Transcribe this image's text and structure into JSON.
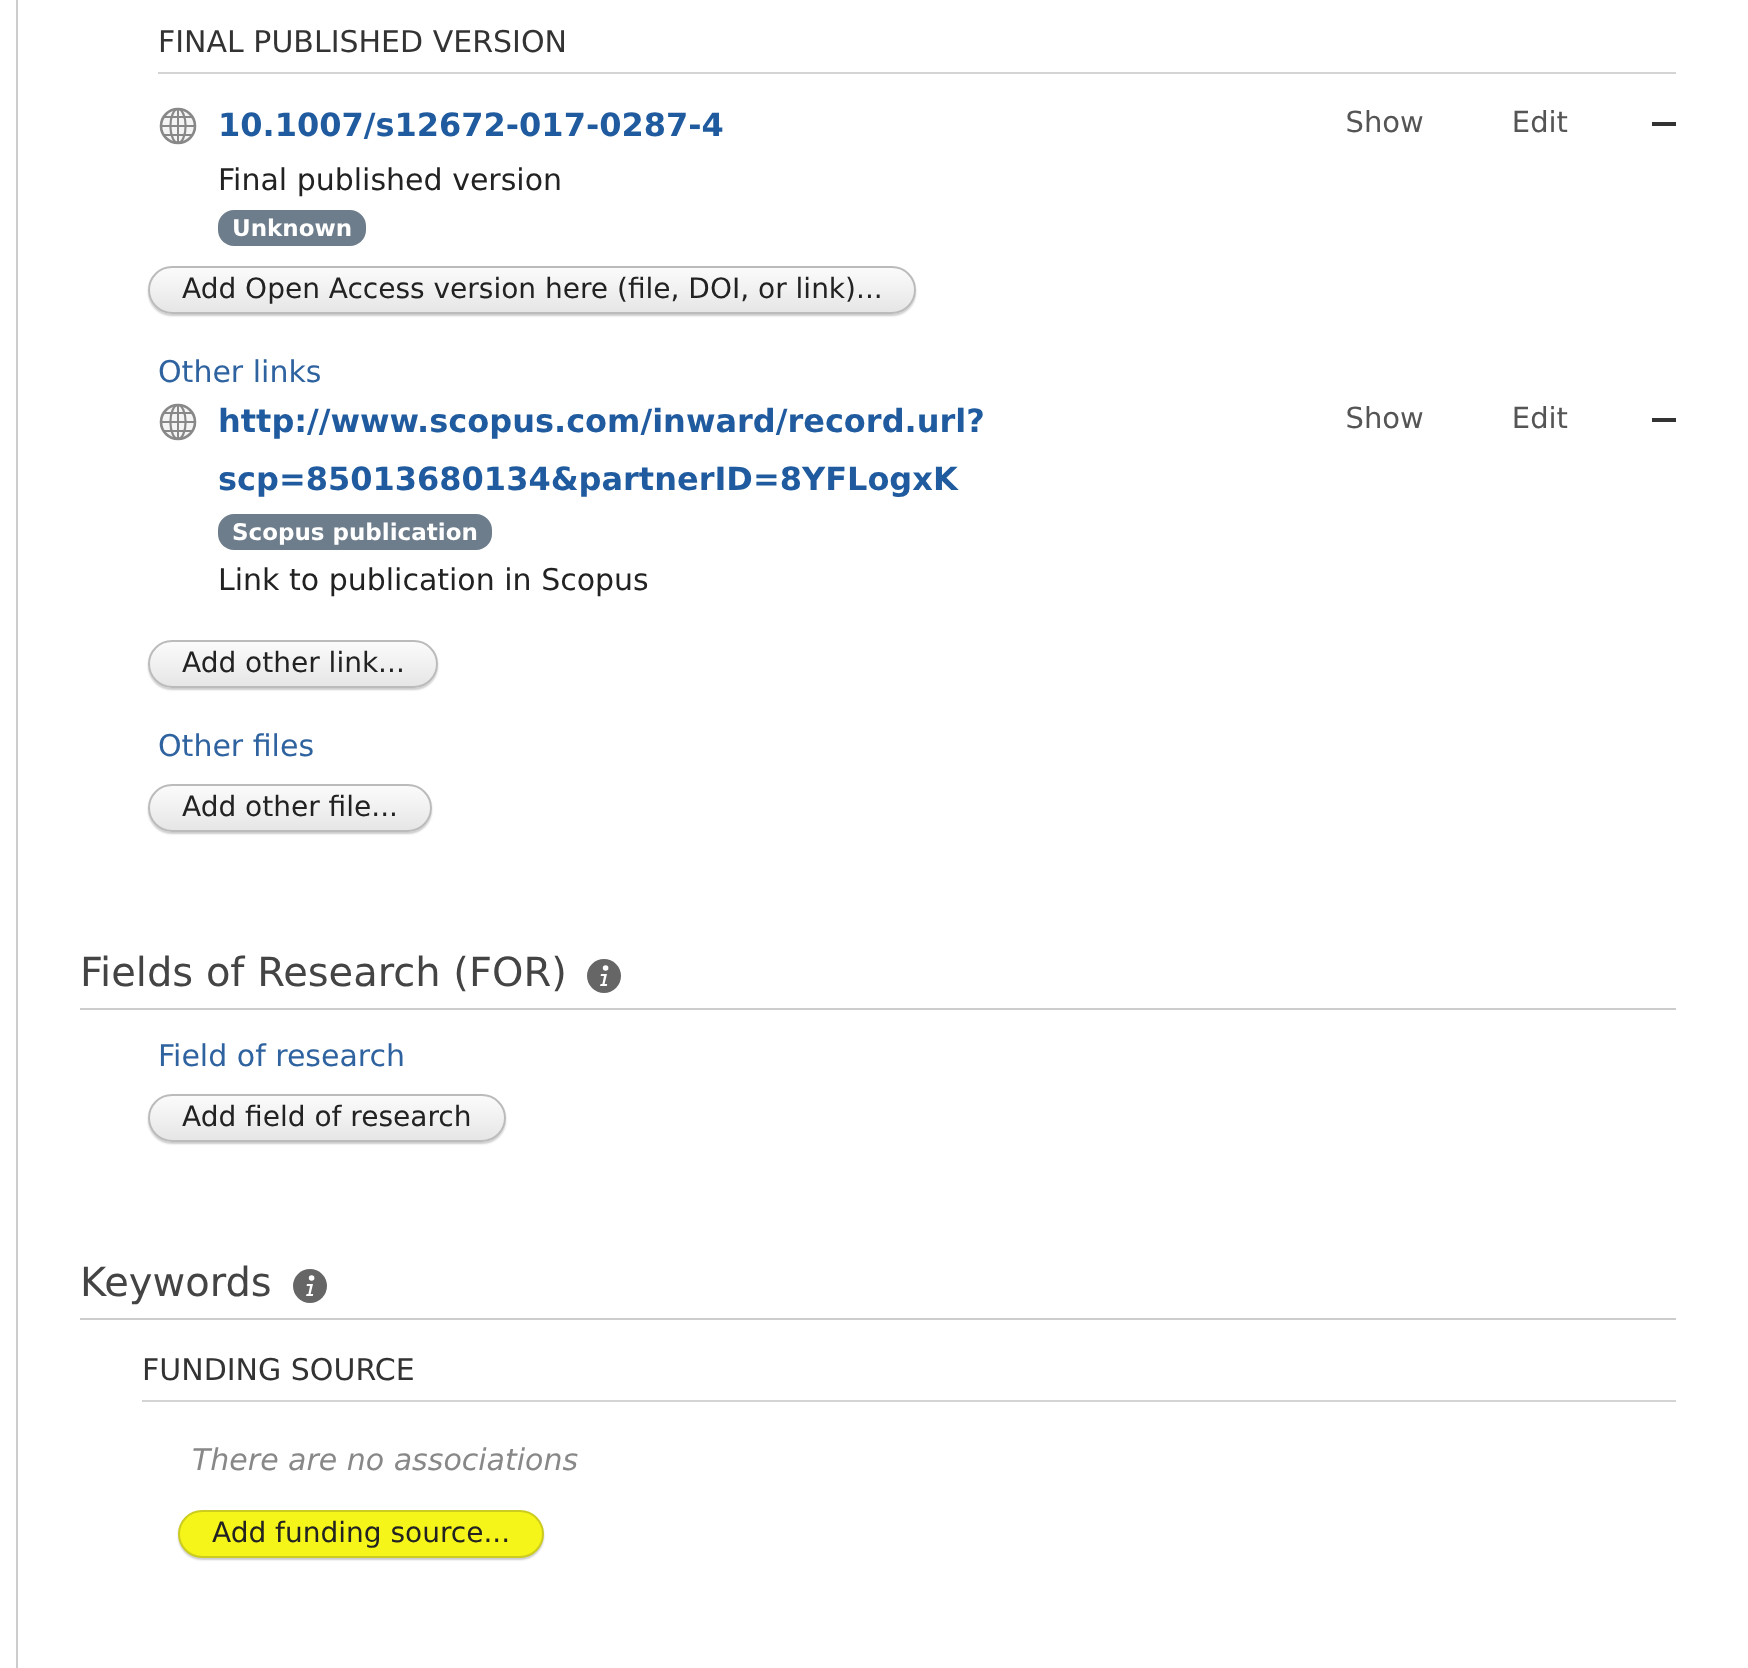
{
  "published": {
    "heading": "FINAL PUBLISHED VERSION",
    "links": [
      {
        "lines": [
          {
            "kind": "url",
            "text": "10.1007/s12672-017-0287-4"
          },
          {
            "kind": "text",
            "text": "Final published version"
          },
          {
            "kind": "badge",
            "text": "Unknown"
          }
        ],
        "actions": [
          "Show",
          "Edit"
        ]
      }
    ],
    "add_button": "Add Open Access version here (file, DOI, or link)..."
  },
  "other_links": {
    "label": "Other links",
    "links": [
      {
        "lines": [
          {
            "kind": "url",
            "text": "http://www.scopus.com/inward/record.url?"
          },
          {
            "kind": "url",
            "text": "scp=85013680134&partnerID=8YFLogxK"
          },
          {
            "kind": "badge",
            "text": "Scopus publication"
          },
          {
            "kind": "text",
            "text": "Link to publication in Scopus"
          }
        ],
        "actions": [
          "Show",
          "Edit"
        ]
      }
    ],
    "add_button": "Add other link..."
  },
  "other_files": {
    "label": "Other files",
    "add_button": "Add other file..."
  },
  "for_section": {
    "title": "Fields of Research (FOR)",
    "label": "Field of research",
    "add_button": "Add field of research"
  },
  "keywords": {
    "title": "Keywords",
    "subheading": "FUNDING SOURCE",
    "empty_text": "There are no associations",
    "add_button": {
      "text": "Add funding source...",
      "highlighted": true
    }
  }
}
